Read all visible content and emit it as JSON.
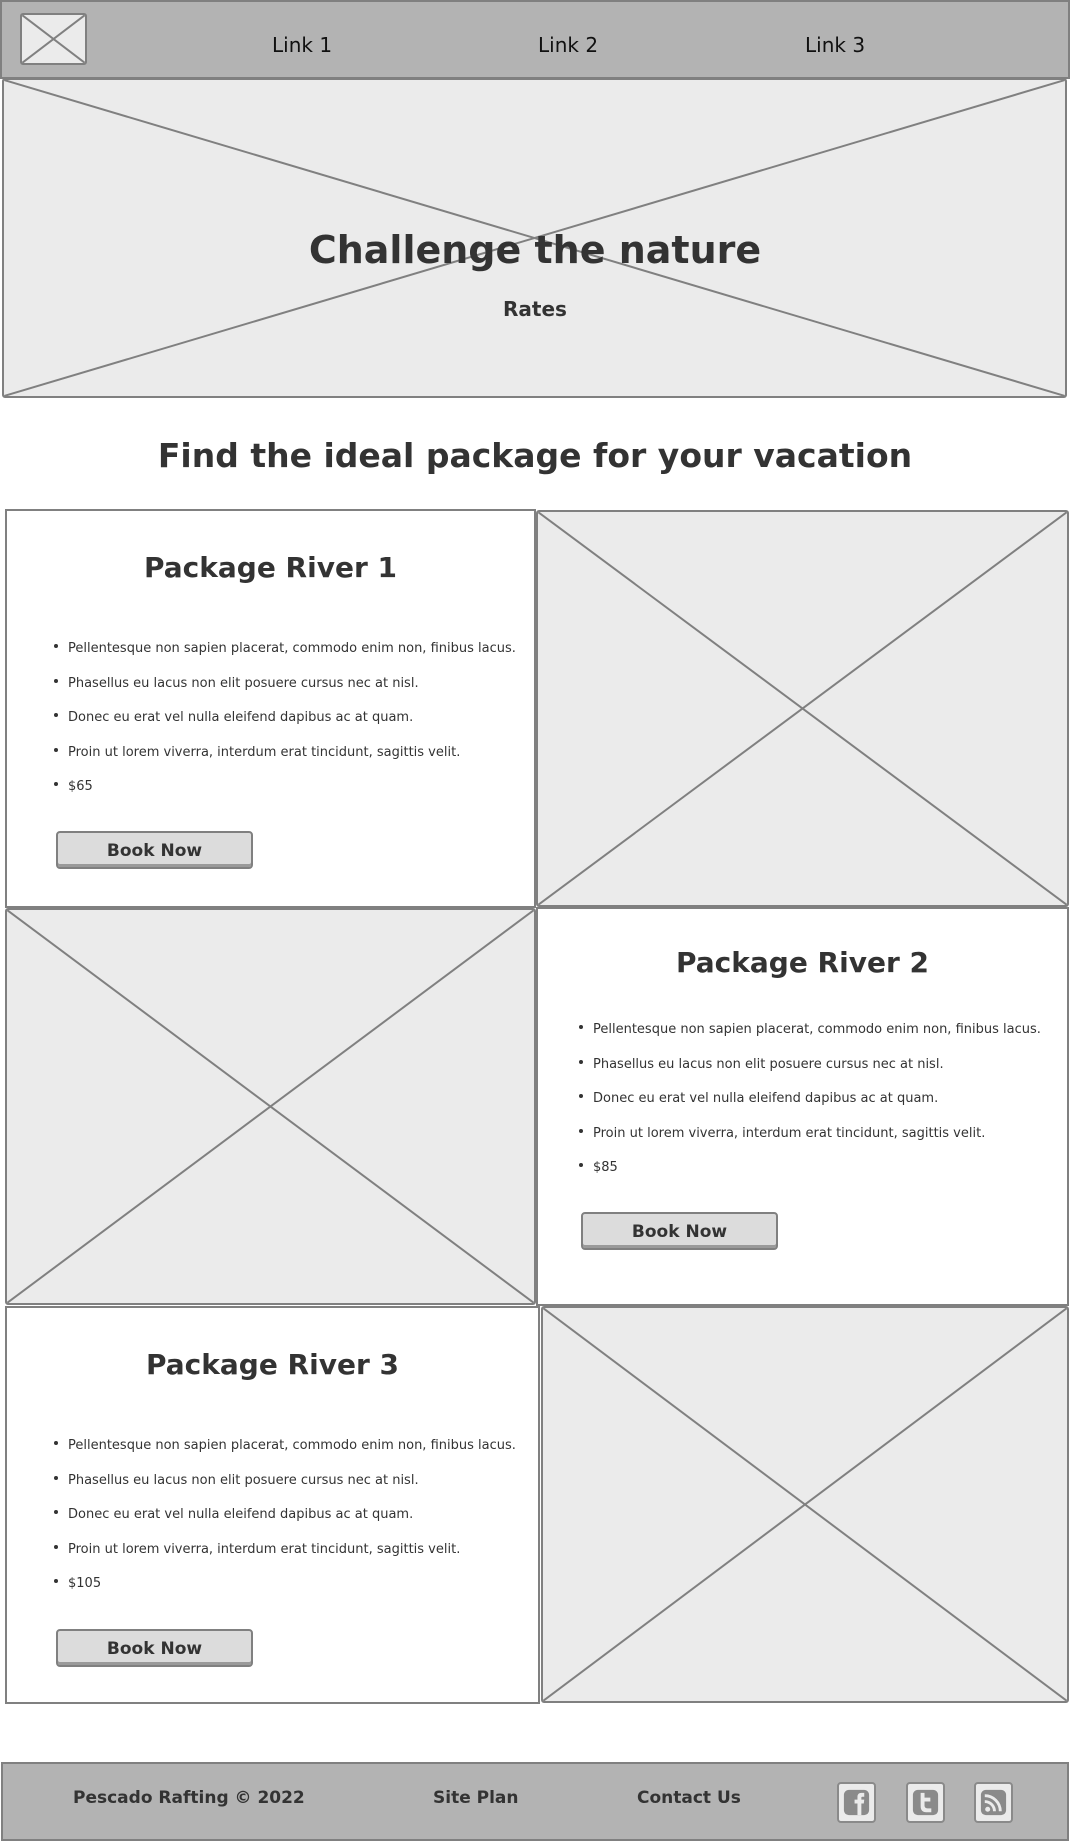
{
  "header": {
    "nav": [
      {
        "label": "Link 1"
      },
      {
        "label": "Link 2"
      },
      {
        "label": "Link 3"
      }
    ]
  },
  "hero": {
    "title": "Challenge the nature",
    "subtitle": "Rates"
  },
  "section": {
    "title": "Find the ideal package for your vacation"
  },
  "packages": [
    {
      "title": "Package River 1",
      "features": [
        "Pellentesque non sapien placerat, commodo enim non, finibus lacus.",
        "Phasellus eu lacus non elit posuere cursus nec at nisl.",
        "Donec eu erat vel nulla eleifend dapibus ac at quam.",
        "Proin ut lorem viverra, interdum erat tincidunt, sagittis velit.",
        "$65"
      ],
      "button": "Book Now"
    },
    {
      "title": "Package River 2",
      "features": [
        "Pellentesque non sapien placerat, commodo enim non, finibus lacus.",
        "Phasellus eu lacus non elit posuere cursus nec at nisl.",
        "Donec eu erat vel nulla eleifend dapibus ac at quam.",
        "Proin ut lorem viverra, interdum erat tincidunt, sagittis velit.",
        "$85"
      ],
      "button": "Book Now"
    },
    {
      "title": "Package River 3",
      "features": [
        "Pellentesque non sapien placerat, commodo enim non, finibus lacus.",
        "Phasellus eu lacus non elit posuere cursus nec at nisl.",
        "Donec eu erat vel nulla eleifend dapibus ac at quam.",
        "Proin ut lorem viverra, interdum erat tincidunt, sagittis velit.",
        "$105"
      ],
      "button": "Book Now"
    }
  ],
  "footer": {
    "copyright": "Pescado Rafting © 2022",
    "site_plan": "Site Plan",
    "contact": "Contact Us",
    "social": [
      "facebook-icon",
      "twitter-icon",
      "rss-icon"
    ]
  },
  "colors": {
    "bar_background": "#b3b3b3",
    "placeholder_fill": "#ebebeb",
    "border": "#808080",
    "text": "#333333"
  }
}
